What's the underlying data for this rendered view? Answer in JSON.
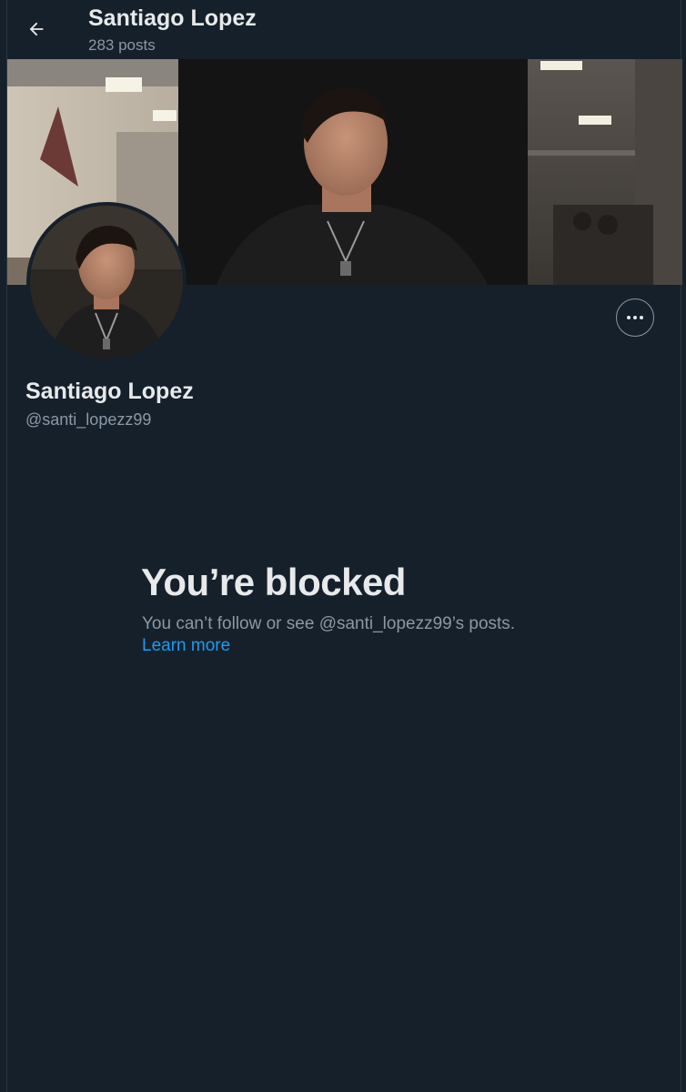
{
  "header": {
    "title": "Santiago Lopez",
    "post_count": "283 posts"
  },
  "profile": {
    "name": "Santiago Lopez",
    "handle": "@santi_lopezz99"
  },
  "blocked": {
    "title": "You’re blocked",
    "description": "You can’t follow or see @santi_lopezz99’s posts.",
    "link_label": "Learn more"
  },
  "icons": {
    "back": "arrow-left-icon",
    "more": "more-horizontal-icon"
  },
  "colors": {
    "background": "#15202b",
    "primary_text": "#e7e9ea",
    "secondary_text": "#8b98a5",
    "link": "#1d9bf0"
  }
}
